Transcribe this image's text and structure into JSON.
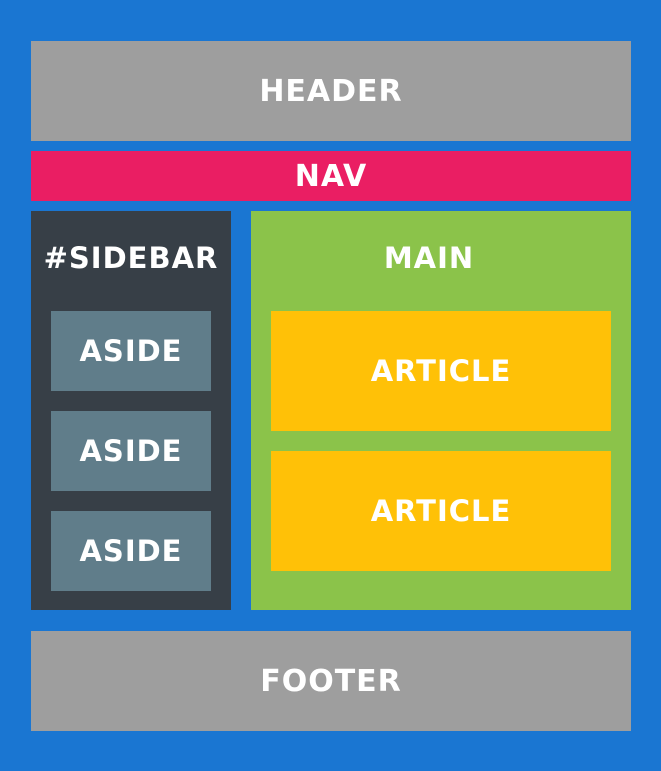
{
  "header": {
    "label": "HEADER"
  },
  "nav": {
    "label": "NAV"
  },
  "sidebar": {
    "label": "#SIDEBAR",
    "asides": [
      "ASIDE",
      "ASIDE",
      "ASIDE"
    ]
  },
  "main": {
    "label": "MAIN",
    "articles": [
      "ARTICLE",
      "ARTICLE"
    ]
  },
  "footer": {
    "label": "FOOTER"
  },
  "colors": {
    "background": "#1a76d2",
    "header": "#9e9e9e",
    "nav": "#ea1e63",
    "sidebar": "#373f47",
    "aside": "#607d8a",
    "main": "#8bc34a",
    "article": "#ffc107",
    "footer": "#9e9e9e",
    "text": "#ffffff"
  }
}
